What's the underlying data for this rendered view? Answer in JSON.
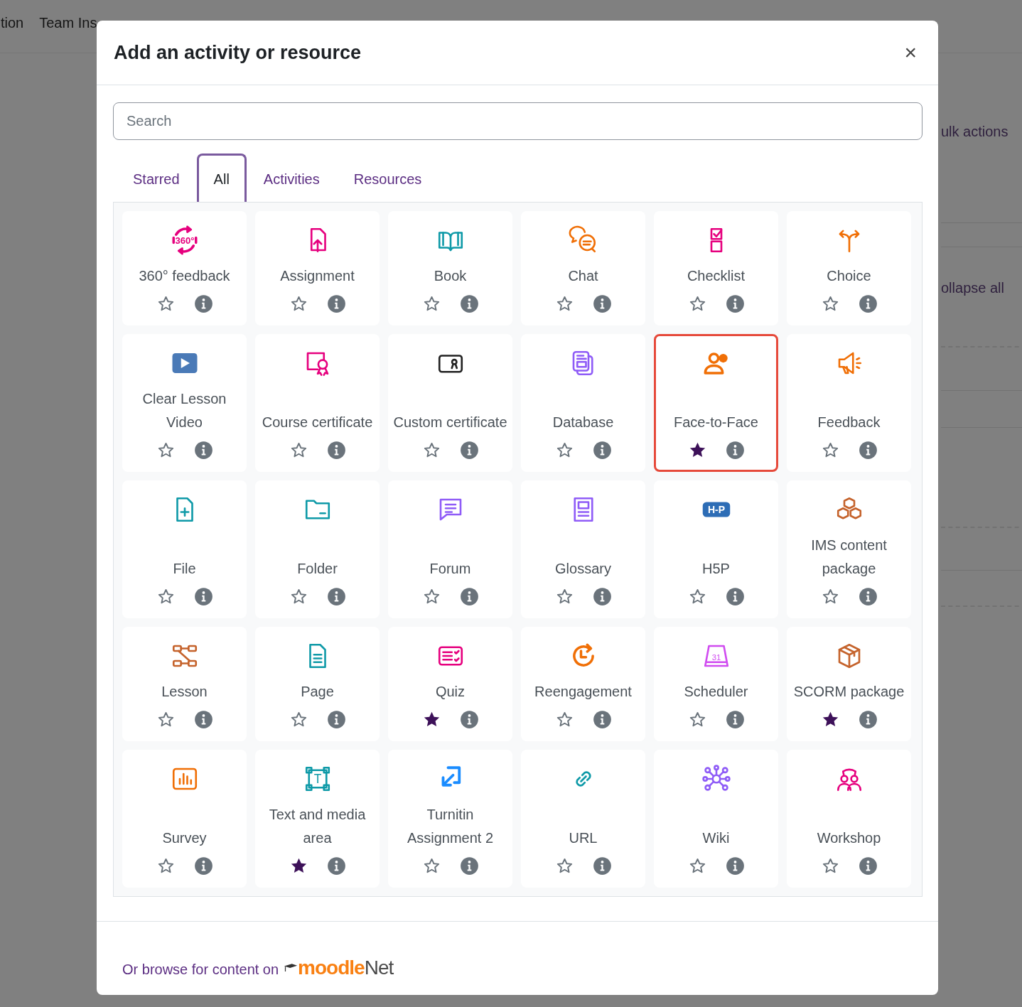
{
  "background": {
    "nav_items": [
      "tion",
      "Team Ins"
    ],
    "side_texts": [
      "ulk actions",
      "ollapse all"
    ]
  },
  "modal": {
    "title": "Add an activity or resource",
    "close": "×",
    "search": {
      "placeholder": "Search"
    },
    "tabs": [
      {
        "label": "Starred",
        "selected": false
      },
      {
        "label": "All",
        "selected": true
      },
      {
        "label": "Activities",
        "selected": false
      },
      {
        "label": "Resources",
        "selected": false
      }
    ],
    "items": [
      {
        "name": "360° feedback",
        "icon_label": "360°",
        "starred": false,
        "focused": false
      },
      {
        "name": "Assignment",
        "starred": false,
        "focused": false
      },
      {
        "name": "Book",
        "starred": false,
        "focused": false
      },
      {
        "name": "Chat",
        "starred": false,
        "focused": false
      },
      {
        "name": "Checklist",
        "starred": false,
        "focused": false
      },
      {
        "name": "Choice",
        "starred": false,
        "focused": false
      },
      {
        "name": "Clear Lesson Video",
        "starred": false,
        "focused": false
      },
      {
        "name": "Course certificate",
        "starred": false,
        "focused": false
      },
      {
        "name": "Custom certificate",
        "starred": false,
        "focused": false
      },
      {
        "name": "Database",
        "starred": false,
        "focused": false
      },
      {
        "name": "Face-to-Face",
        "starred": true,
        "focused": true
      },
      {
        "name": "Feedback",
        "starred": false,
        "focused": false
      },
      {
        "name": "File",
        "starred": false,
        "focused": false
      },
      {
        "name": "Folder",
        "starred": false,
        "focused": false
      },
      {
        "name": "Forum",
        "starred": false,
        "focused": false
      },
      {
        "name": "Glossary",
        "starred": false,
        "focused": false
      },
      {
        "name": "H5P",
        "icon_label": "H-P",
        "starred": false,
        "focused": false
      },
      {
        "name": "IMS content package",
        "starred": false,
        "focused": false
      },
      {
        "name": "Lesson",
        "starred": false,
        "focused": false
      },
      {
        "name": "Page",
        "starred": false,
        "focused": false
      },
      {
        "name": "Quiz",
        "starred": true,
        "focused": false
      },
      {
        "name": "Reengagement",
        "starred": false,
        "focused": false
      },
      {
        "name": "Scheduler",
        "icon_label": "31",
        "starred": false,
        "focused": false
      },
      {
        "name": "SCORM package",
        "starred": true,
        "focused": false
      },
      {
        "name": "Survey",
        "starred": false,
        "focused": false
      },
      {
        "name": "Text and media area",
        "icon_label": "T",
        "starred": true,
        "focused": false
      },
      {
        "name": "Turnitin Assignment 2",
        "starred": false,
        "focused": false
      },
      {
        "name": "URL",
        "starred": false,
        "focused": false
      },
      {
        "name": "Wiki",
        "starred": false,
        "focused": false
      },
      {
        "name": "Workshop",
        "starred": false,
        "focused": false
      }
    ],
    "footer": {
      "text": "Or browse for content on",
      "logo": "moodle",
      "logo_suffix": "Net"
    }
  }
}
